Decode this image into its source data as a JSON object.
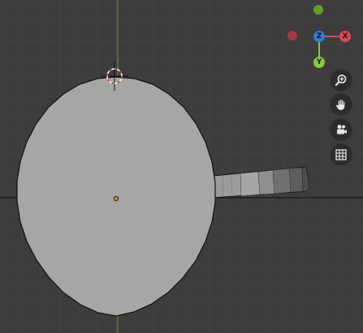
{
  "viewport": {
    "background": "#3d3d3d",
    "grid_color": "#474747",
    "y_axis_color": "#6a8a2a",
    "x_axis_color": "#1a1a1a"
  },
  "scene": {
    "mesh_fill": "#a5a7a5",
    "mesh_outline": "#111111",
    "origin_color": "#e08a1e",
    "cursor_ring_colors": [
      "#c73a3a",
      "#ffffff"
    ]
  },
  "gizmo": {
    "labels": {
      "z": "Z",
      "x": "X",
      "y": "Y"
    },
    "colors": {
      "z": "#3a7bd5",
      "x": "#e0455c",
      "y": "#8dc63f",
      "neg_x": "#a83848",
      "neg_z": "#6a9a2a"
    }
  },
  "nav_tools": [
    {
      "icon": "zoom-icon"
    },
    {
      "icon": "pan-hand-icon"
    },
    {
      "icon": "camera-icon"
    },
    {
      "icon": "grid-ortho-icon"
    }
  ]
}
